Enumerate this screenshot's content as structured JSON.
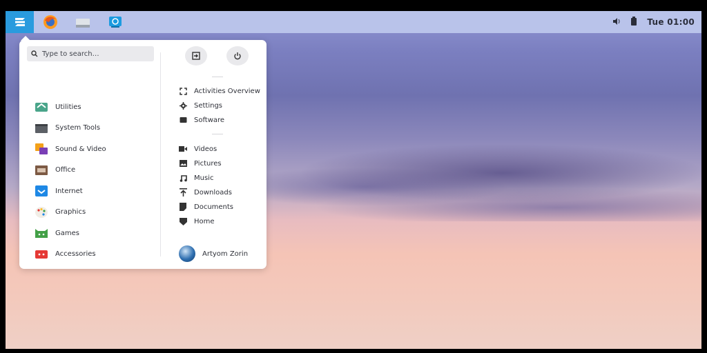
{
  "panel": {
    "menu_icon": "zorin-logo-icon",
    "apps": [
      {
        "name": "firefox-icon"
      },
      {
        "name": "files-icon"
      },
      {
        "name": "software-store-icon"
      }
    ],
    "volume_icon": "volume-icon",
    "battery_icon": "battery-icon",
    "clock": "Tue 01:00"
  },
  "menu": {
    "search": {
      "placeholder": "Type to search…"
    },
    "categories": [
      {
        "label": "Utilities",
        "icon": "utilities-icon"
      },
      {
        "label": "System Tools",
        "icon": "system-tools-icon"
      },
      {
        "label": "Sound & Video",
        "icon": "sound-video-icon"
      },
      {
        "label": "Office",
        "icon": "office-icon"
      },
      {
        "label": "Internet",
        "icon": "internet-icon"
      },
      {
        "label": "Graphics",
        "icon": "graphics-icon"
      },
      {
        "label": "Games",
        "icon": "games-icon"
      },
      {
        "label": "Accessories",
        "icon": "accessories-icon"
      }
    ],
    "actions": {
      "logout_icon": "logout-icon",
      "power_icon": "power-icon"
    },
    "system_links": [
      {
        "label": "Activities Overview",
        "icon": "fullscreen-icon"
      },
      {
        "label": "Settings",
        "icon": "gear-icon"
      },
      {
        "label": "Software",
        "icon": "software-icon"
      }
    ],
    "places": [
      {
        "label": "Videos",
        "icon": "video-icon"
      },
      {
        "label": "Pictures",
        "icon": "picture-icon"
      },
      {
        "label": "Music",
        "icon": "music-icon"
      },
      {
        "label": "Downloads",
        "icon": "download-icon"
      },
      {
        "label": "Documents",
        "icon": "document-icon"
      },
      {
        "label": "Home",
        "icon": "home-icon"
      }
    ],
    "user": {
      "name": "Artyom Zorin",
      "icon": "avatar-icon"
    }
  }
}
